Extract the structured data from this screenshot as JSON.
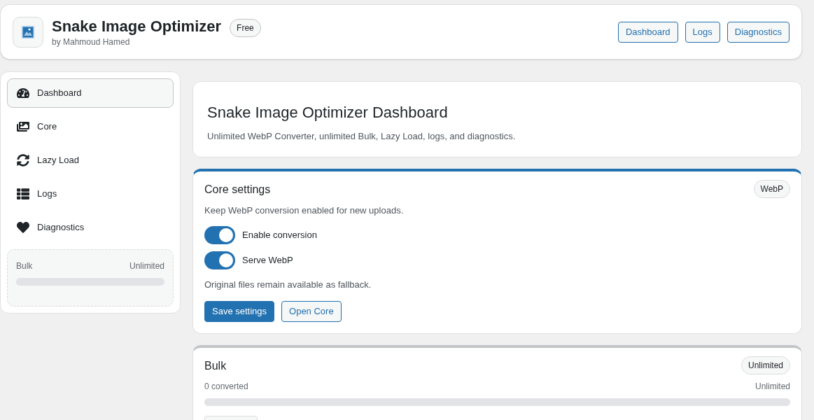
{
  "header": {
    "title": "Snake Image Optimizer",
    "byline": "by Mahmoud Hamed",
    "badge": "Free",
    "nav": [
      {
        "label": "Dashboard"
      },
      {
        "label": "Logs"
      },
      {
        "label": "Diagnostics"
      }
    ]
  },
  "sidebar": {
    "items": [
      {
        "label": "Dashboard",
        "selected": true
      },
      {
        "label": "Core",
        "selected": false
      },
      {
        "label": "Lazy Load",
        "selected": false
      },
      {
        "label": "Logs",
        "selected": false
      },
      {
        "label": "Diagnostics",
        "selected": false
      }
    ],
    "meter": {
      "label": "Bulk",
      "value": "Unlimited"
    }
  },
  "intro": {
    "title": "Snake Image Optimizer Dashboard",
    "subtitle": "Unlimited WebP Converter, unlimited Bulk, Lazy Load, logs, and diagnostics."
  },
  "core_card": {
    "color": "#2271b1",
    "title": "Core settings",
    "badge": "WebP",
    "description": "Keep WebP conversion enabled for new uploads.",
    "toggles": [
      {
        "label": "Enable conversion",
        "on": true
      },
      {
        "label": "Serve WebP",
        "on": true
      }
    ],
    "note": "Original files remain available as fallback.",
    "buttons": [
      {
        "label": "Save settings",
        "kind": "primary"
      },
      {
        "label": "Open Core",
        "kind": "secondary"
      }
    ]
  },
  "bulk_card": {
    "color": "#c3c4c7",
    "title": "Bulk",
    "badge": "Unlimited",
    "count": "0 converted",
    "limit": "Unlimited"
  }
}
